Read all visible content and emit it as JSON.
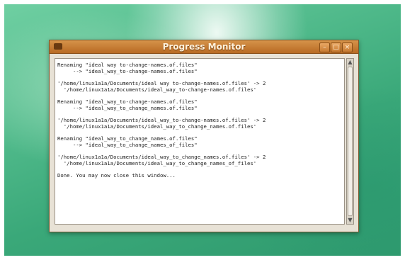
{
  "window": {
    "title": "Progress Monitor",
    "buttons": {
      "minimize": "–",
      "maximize": "□",
      "close": "×"
    }
  },
  "log": {
    "lines": [
      "Renaming \"ideal way to-change-names.of.files\"",
      "     --> \"ideal_way_to-change-names.of.files\"",
      "",
      "'/home/linux1a1a/Documents/ideal way to-change-names.of.files' -> 2",
      "  '/home/linux1a1a/Documents/ideal_way_to-change-names.of.files'",
      "",
      "Renaming \"ideal_way_to-change-names.of.files\"",
      "     --> \"ideal_way_to_change_names.of.files\"",
      "",
      "'/home/linux1a1a/Documents/ideal_way_to-change-names.of.files' -> 2",
      "  '/home/linux1a1a/Documents/ideal_way_to_change_names.of.files'",
      "",
      "Renaming \"ideal_way_to_change_names.of.files\"",
      "     --> \"ideal_way_to_change_names_of_files\"",
      "",
      "'/home/linux1a1a/Documents/ideal_way_to_change_names.of.files' -> 2",
      "  '/home/linux1a1a/Documents/ideal_way_to_change_names_of_files'",
      "",
      "Done. You may now close this window..."
    ]
  },
  "scrollbar": {
    "up": "▲",
    "down": "▼"
  }
}
